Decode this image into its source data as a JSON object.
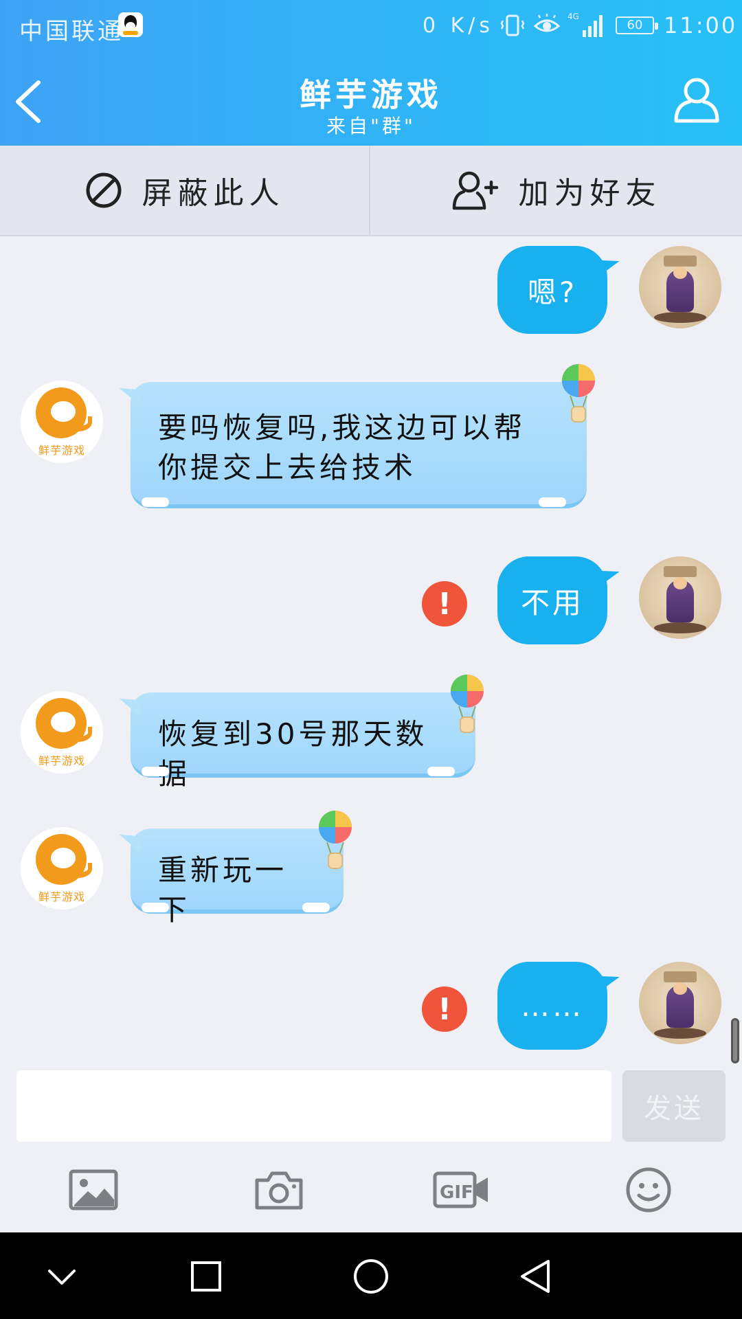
{
  "status_bar": {
    "carrier": "中国联通",
    "net_speed": "0 K/s",
    "network": "4G",
    "battery": "60",
    "time": "11:00"
  },
  "header": {
    "title": "鲜芋游戏",
    "subtitle": "来自\"群\""
  },
  "actions": {
    "block_label": "屏蔽此人",
    "add_friend_label": "加为好友"
  },
  "messages": [
    {
      "from": "me",
      "text": "嗯?"
    },
    {
      "from": "them",
      "text": "要吗恢复吗,我这边可以帮你提交上去给技术"
    },
    {
      "from": "me",
      "text": "不用",
      "failed": true
    },
    {
      "from": "them",
      "text": "恢复到30号那天数据"
    },
    {
      "from": "them",
      "text": "重新玩一下"
    },
    {
      "from": "me",
      "text": "……",
      "failed": true
    }
  ],
  "bubble_lines": {
    "msg1_line1": "要吗恢复吗,我这边可以帮",
    "msg1_line2": "你提交上去给技术"
  },
  "avatars": {
    "game_brand": "鲜芋游戏"
  },
  "error_mark": "!",
  "input": {
    "placeholder": "",
    "value": "",
    "send_label": "发送"
  },
  "toolbar": [
    "image-icon",
    "camera-icon",
    "gif-icon",
    "emoji-icon"
  ],
  "colors": {
    "header_start": "#3ea3f5",
    "header_end": "#27c0f6",
    "my_bubble": "#19b0ef",
    "their_bubble": "#a8dafb",
    "error": "#f0553c",
    "brand_orange": "#f29a1c"
  }
}
